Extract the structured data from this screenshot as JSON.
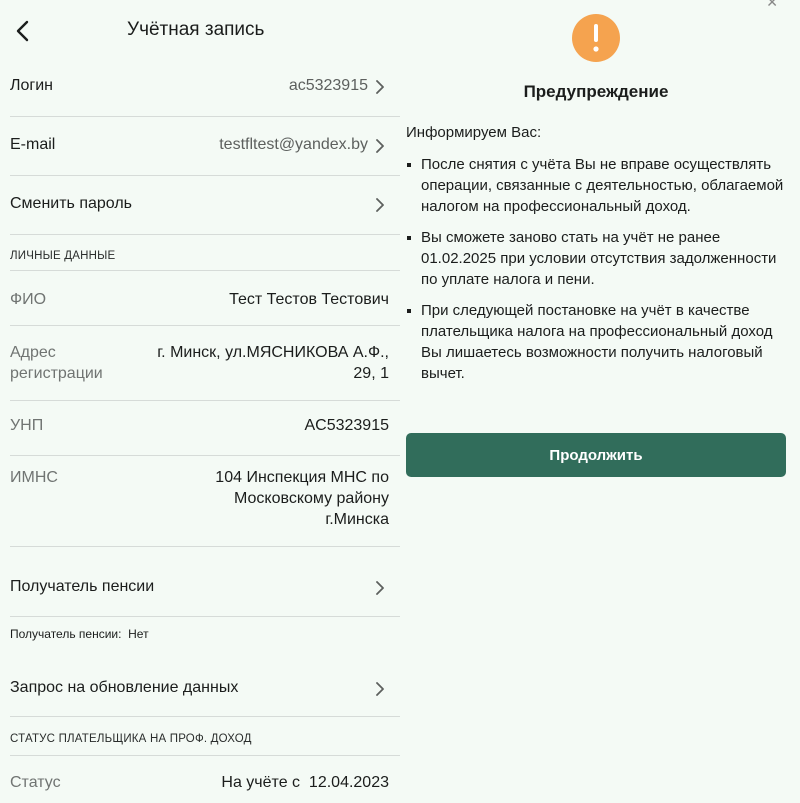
{
  "header": {
    "title": "Учётная запись"
  },
  "account": {
    "login_label": "Логин",
    "login_value": "ac5323915",
    "email_label": "E-mail",
    "email_value": "testfltest@yandex.by",
    "change_password_label": "Сменить пароль"
  },
  "personal": {
    "section_title": "ЛИЧНЫЕ ДАННЫЕ",
    "fio_label": "ФИО",
    "fio_value": "Тест Тестов Тестович",
    "address_label_1": "Адрес",
    "address_label_2": "регистрации",
    "address_value_1": "г. Минск, ул.МЯСНИКОВА А.Ф.,",
    "address_value_2": "29, 1",
    "unp_label": "УНП",
    "unp_value": "AC5323915",
    "imns_label": "ИМНС",
    "imns_value_1": "104 Инспекция МНС по",
    "imns_value_2": "Московскому району",
    "imns_value_3": "г.Минска"
  },
  "pension": {
    "label": "Получатель пенсии",
    "note_label": "Получатель пенсии:",
    "note_value": "Нет"
  },
  "update_request": {
    "label": "Запрос на обновление данных"
  },
  "status": {
    "section_title": "СТАТУС ПЛАТЕЛЬЩИКА НА ПРОФ. ДОХОД",
    "label": "Статус",
    "value_prefix": "На учёте с",
    "value_date": "12.04.2023"
  },
  "dialog": {
    "icon": "exclamation-warning-icon",
    "icon_color": "#f5a34f",
    "title": "Предупреждение",
    "intro": "Информируем Вас:",
    "bullets": [
      "После снятия с учёта Вы не вправе осуществлять операции, связанные с деятельностью, облагаемой налогом на профессиональный доход.",
      "Вы сможете заново стать на учёт не ранее 01.02.2025 при условии отсутствия задолженности по уплате налога и пени.",
      "При следующей постановке на учёт в качестве плательщика налога на профессиональный доход Вы лишаетесь возможности получить налоговый вычет."
    ],
    "button_label": "Продолжить",
    "button_color": "#316d5b"
  },
  "colors": {
    "background": "#f4faf5",
    "divider": "#d6dbd8"
  }
}
